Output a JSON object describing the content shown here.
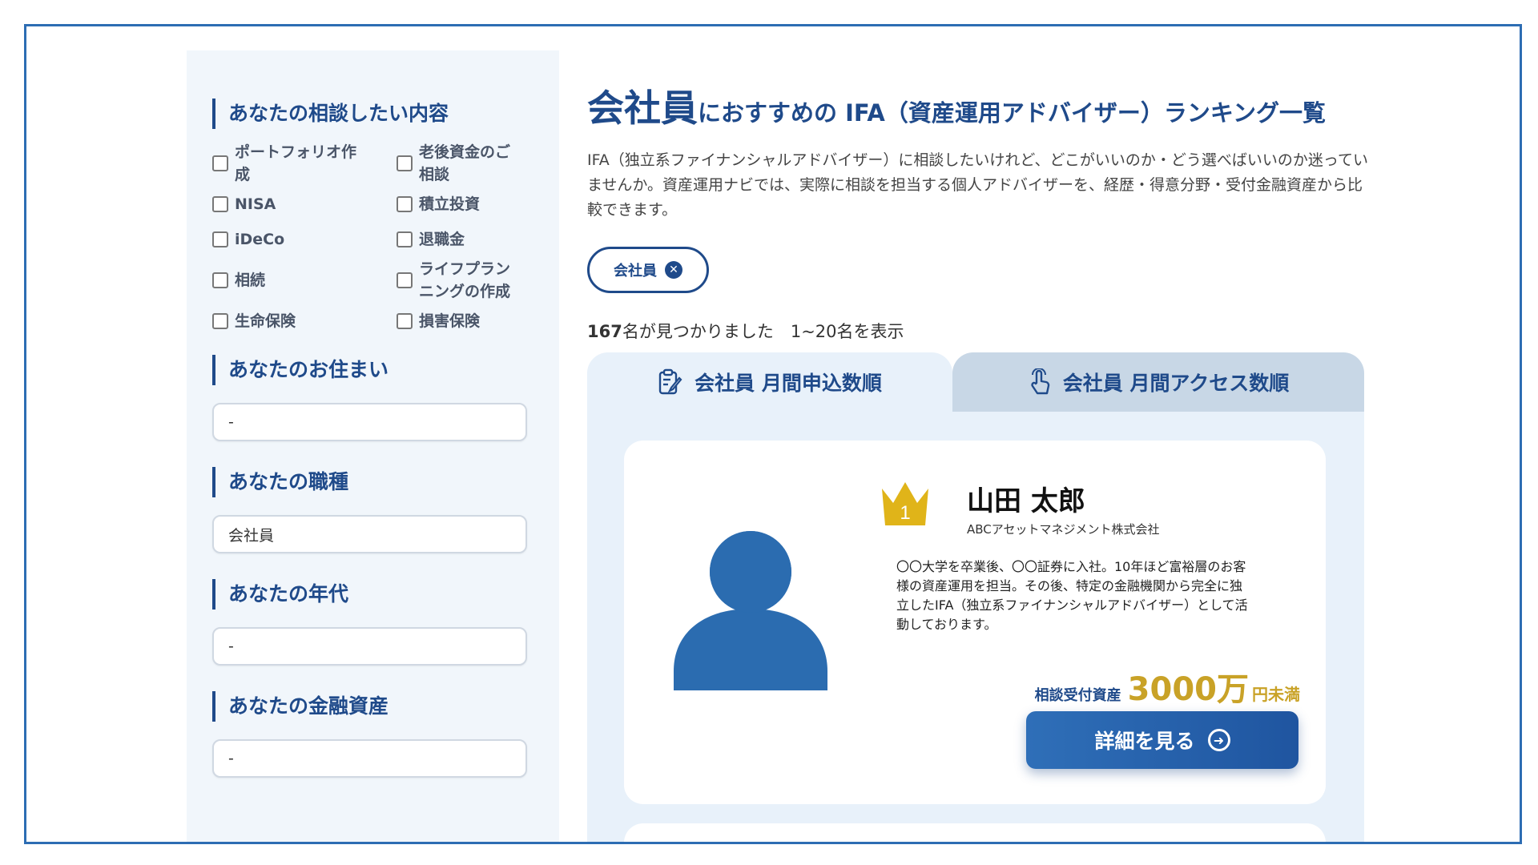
{
  "sidebar": {
    "consult_heading": "あなたの相談したい内容",
    "consult_options": [
      {
        "label": "ポートフォリオ作成"
      },
      {
        "label": "老後資金のご相談"
      },
      {
        "label": "NISA"
      },
      {
        "label": "積立投資"
      },
      {
        "label": "iDeCo"
      },
      {
        "label": "退職金"
      },
      {
        "label": "相続"
      },
      {
        "label": "ライフプランニングの作成"
      },
      {
        "label": "生命保険"
      },
      {
        "label": "損害保険"
      }
    ],
    "residence_heading": "あなたのお住まい",
    "residence_value": "-",
    "occupation_heading": "あなたの職種",
    "occupation_value": "会社員",
    "age_heading": "あなたの年代",
    "age_value": "-",
    "assets_heading": "あなたの金融資産",
    "assets_value": "-"
  },
  "main": {
    "title_big": "会社員",
    "title_rest": "におすすめの IFA（資産運用アドバイザー）ランキング一覧",
    "lead": "IFA（独立系ファイナンシャルアドバイザー）に相談したいけれど、どこがいいのか・どう選べばいいのか迷っていませんか。資産運用ナビでは、実際に相談を担当する個人アドバイザーを、経歴・得意分野・受付金融資産から比較できます。",
    "tag_label": "会社員",
    "result_count": "167",
    "result_text": "名が見つかりました　1~20名を表示",
    "tabs": [
      {
        "label": "会社員 月間申込数順",
        "icon": "clipboard-edit-icon"
      },
      {
        "label": "会社員 月間アクセス数順",
        "icon": "tap-hand-icon"
      }
    ]
  },
  "card": {
    "rank": "1",
    "name": "山田 太郎",
    "company": "ABCアセットマネジメント株式会社",
    "description": "〇〇大学を卒業後、〇〇証券に入社。10年ほど富裕層のお客様の資産運用を担当。その後、特定の金融機関から完全に独立したIFA（独立系ファイナンシャルアドバイザー）として活動しております。",
    "asset_label": "相談受付資産",
    "asset_amount": "3000万",
    "asset_unit": "円未満",
    "detail_button": "詳細を見る"
  },
  "colors": {
    "primary": "#1f4a8a",
    "accent_gold": "#c9a227",
    "sidebar_bg": "#f1f6fb",
    "avatar_blue": "#2b6cb0"
  }
}
